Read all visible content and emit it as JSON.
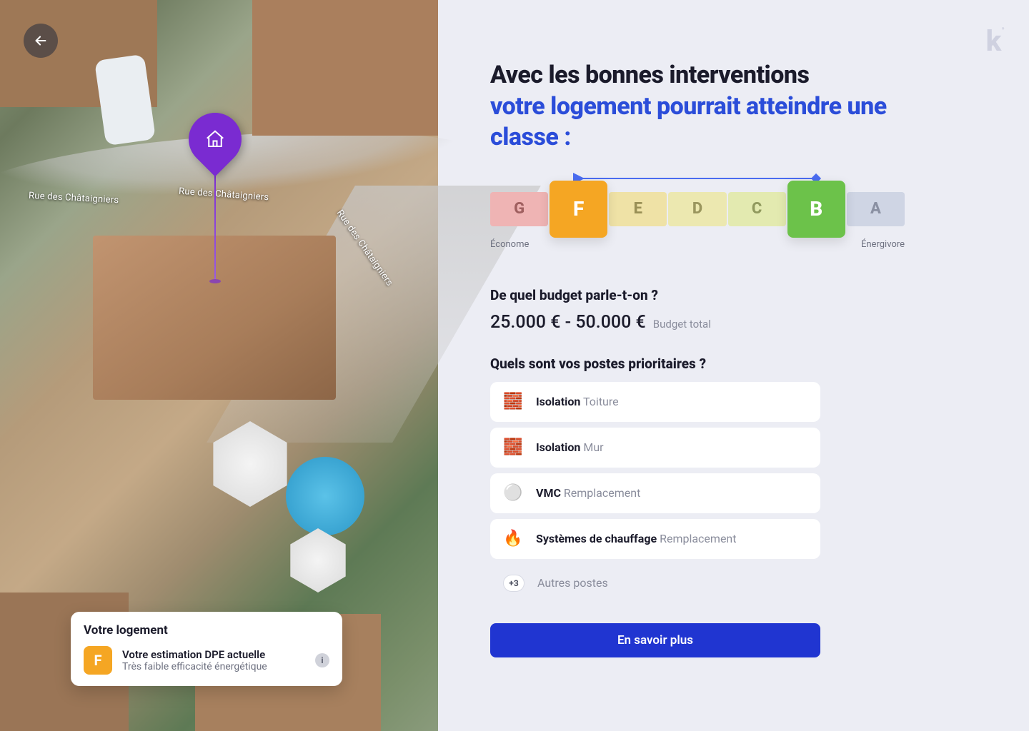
{
  "map": {
    "street_label": "Rue des Châtaigniers",
    "back_button": "Retour"
  },
  "info_card": {
    "title": "Votre logement",
    "dpe_letter": "F",
    "line1": "Votre estimation DPE actuelle",
    "line2": "Très faible efficacité énergétique",
    "info_glyph": "i"
  },
  "headline": {
    "dark": "Avec les bonnes interventions",
    "blue": "votre logement pourrait atteindre une classe :"
  },
  "dpe_scale": {
    "cells": [
      {
        "letter": "G",
        "color": "#efb4b4",
        "text": "#a06060"
      },
      {
        "letter": "F",
        "color": "#f5a623",
        "text": "#ffffff",
        "big": true
      },
      {
        "letter": "E",
        "color": "#efe2a6",
        "text": "#9a9056"
      },
      {
        "letter": "D",
        "color": "#ece8b0",
        "text": "#9a965e"
      },
      {
        "letter": "C",
        "color": "#e3eab0",
        "text": "#919a5e"
      },
      {
        "letter": "B",
        "color": "#6cc24a",
        "text": "#ffffff",
        "big": true
      },
      {
        "letter": "A",
        "color": "#cfd5e4",
        "text": "#8a90a2"
      }
    ],
    "legend_left": "Économe",
    "legend_right": "Énergivore",
    "current_index": 1,
    "target_index": 5
  },
  "budget": {
    "heading": "De quel budget parle-t-on  ?",
    "value": "25.000 € - 50.000 €",
    "label": "Budget total"
  },
  "priorities": {
    "heading": "Quels sont vos postes prioritaires ?",
    "items": [
      {
        "icon": "🧱",
        "bold": "Isolation",
        "light": "Toiture"
      },
      {
        "icon": "🧱",
        "bold": "Isolation",
        "light": "Mur"
      },
      {
        "icon": "⚪",
        "bold": "VMC",
        "light": "Remplacement"
      },
      {
        "icon": "🔥",
        "bold": "Systèmes de chauffage",
        "light": "Remplacement"
      }
    ],
    "more_badge": "+3",
    "more_label": "Autres postes"
  },
  "cta_label": "En savoir plus",
  "logo_text": "k"
}
